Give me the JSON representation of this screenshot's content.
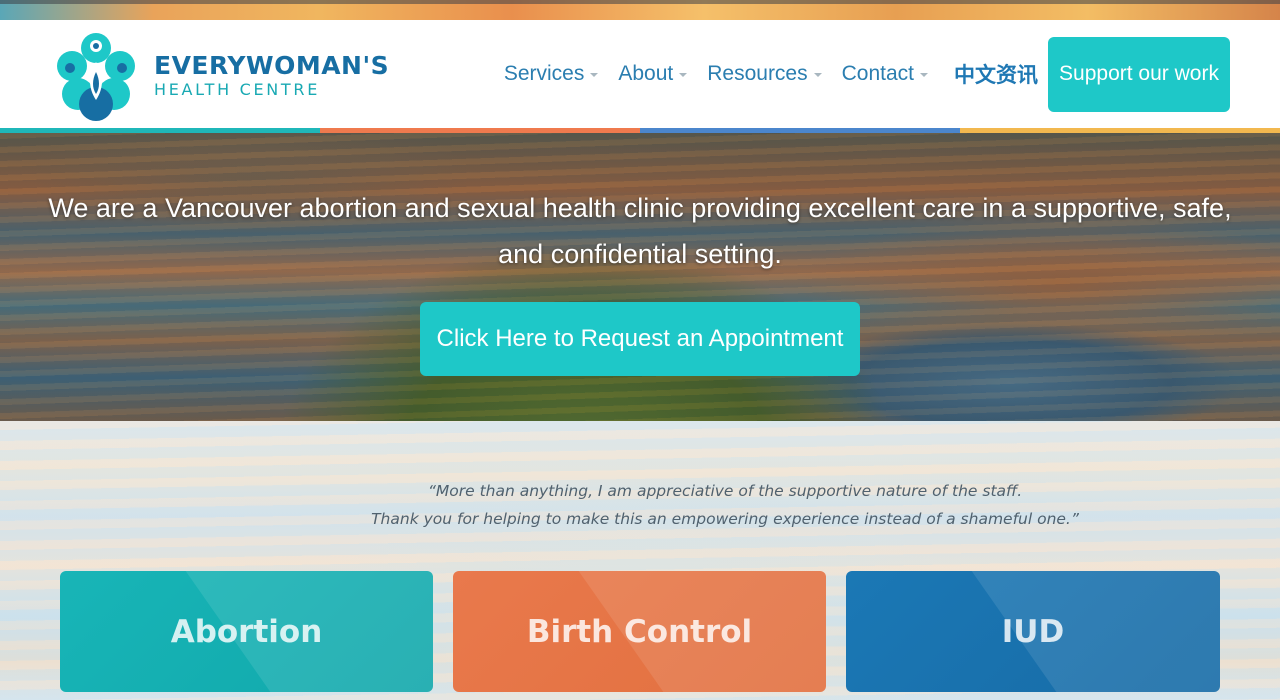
{
  "brand": {
    "name": "EVERYWOMAN'S",
    "subtitle": "HEALTH CENTRE",
    "colors": {
      "teal": "#1ec8c8",
      "blue": "#176ea3",
      "orange": "#e9794c",
      "gold": "#f2b84f"
    }
  },
  "nav": {
    "items": [
      {
        "label": "Services",
        "has_dropdown": true
      },
      {
        "label": "About",
        "has_dropdown": true
      },
      {
        "label": "Resources",
        "has_dropdown": true
      },
      {
        "label": "Contact",
        "has_dropdown": true
      }
    ],
    "chinese_link": "中文资讯",
    "support_button": "Support our work"
  },
  "color_bars": [
    "#1fb7b9",
    "#ef7a4e",
    "#4b86cc",
    "#f2b84f"
  ],
  "hero": {
    "text": "We are a Vancouver abortion and sexual health clinic providing excellent care in a supportive, safe, and confidential setting.",
    "cta": "Click Here to Request an Appointment"
  },
  "testimonial": {
    "line1": "“More than anything, I am appreciative of the supportive nature of the staff.",
    "line2": "Thank you for helping to make this an empowering experience instead of a shameful one.”"
  },
  "cards": [
    {
      "label": "Abortion",
      "color": "#18b5b7"
    },
    {
      "label": "Birth Control",
      "color": "#e9794c"
    },
    {
      "label": "IUD",
      "color": "#1b78b5"
    }
  ]
}
